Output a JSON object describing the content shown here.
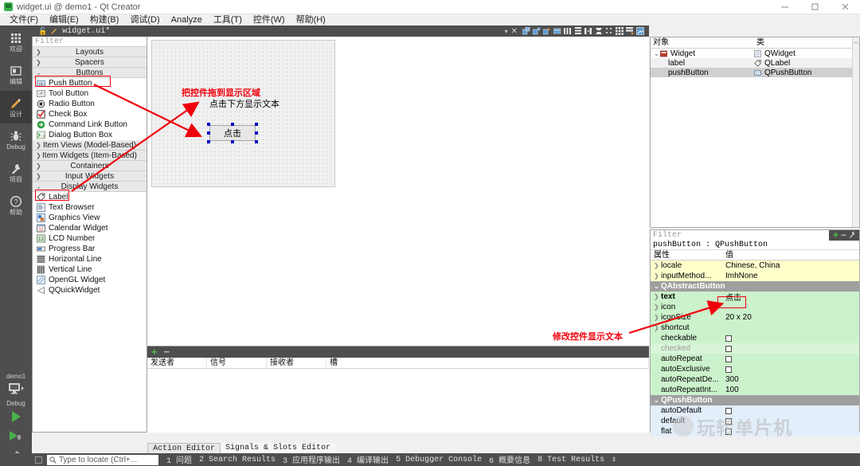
{
  "window": {
    "title": "widget.ui @ demo1 - Qt Creator",
    "minimize": "—",
    "maximize": "❐",
    "close": "✕"
  },
  "menubar": {
    "items": [
      "文件(F)",
      "编辑(E)",
      "构建(B)",
      "调试(D)",
      "Analyze",
      "工具(T)",
      "控件(W)",
      "帮助(H)"
    ]
  },
  "rail": {
    "items": [
      {
        "label": "欢迎",
        "icon": "grid-icon"
      },
      {
        "label": "编辑",
        "icon": "edit-icon"
      },
      {
        "label": "设计",
        "icon": "pencil-icon"
      },
      {
        "label": "Debug",
        "icon": "bug-icon"
      },
      {
        "label": "项目",
        "icon": "wrench-icon"
      },
      {
        "label": "帮助",
        "icon": "question-icon"
      }
    ],
    "kit_name": "demo1",
    "build_config": "Debug"
  },
  "editor_toolbar": {
    "filename": "widget.ui*",
    "close_label": "✕"
  },
  "widgetbox": {
    "filter_placeholder": "Filter",
    "groups": [
      {
        "label": "Layouts",
        "expanded": false,
        "items": []
      },
      {
        "label": "Spacers",
        "expanded": false,
        "items": []
      },
      {
        "label": "Buttons",
        "expanded": true,
        "items": [
          {
            "label": "Push Button",
            "icon": "push-button-icon"
          },
          {
            "label": "Tool Button",
            "icon": "tool-button-icon"
          },
          {
            "label": "Radio Button",
            "icon": "radio-button-icon"
          },
          {
            "label": "Check Box",
            "icon": "check-box-icon"
          },
          {
            "label": "Command Link Button",
            "icon": "command-link-icon"
          },
          {
            "label": "Dialog Button Box",
            "icon": "dialog-button-box-icon"
          }
        ]
      },
      {
        "label": "Item Views (Model-Based)",
        "expanded": false,
        "items": []
      },
      {
        "label": "Item Widgets (Item-Based)",
        "expanded": false,
        "items": []
      },
      {
        "label": "Containers",
        "expanded": false,
        "items": []
      },
      {
        "label": "Input Widgets",
        "expanded": false,
        "items": []
      },
      {
        "label": "Display Widgets",
        "expanded": true,
        "items": [
          {
            "label": "Label",
            "icon": "label-icon"
          },
          {
            "label": "Text Browser",
            "icon": "text-browser-icon"
          },
          {
            "label": "Graphics View",
            "icon": "graphics-view-icon"
          },
          {
            "label": "Calendar Widget",
            "icon": "calendar-icon"
          },
          {
            "label": "LCD Number",
            "icon": "lcd-number-icon"
          },
          {
            "label": "Progress Bar",
            "icon": "progress-bar-icon"
          },
          {
            "label": "Horizontal Line",
            "icon": "horizontal-line-icon"
          },
          {
            "label": "Vertical Line",
            "icon": "vertical-line-icon"
          },
          {
            "label": "OpenGL Widget",
            "icon": "opengl-icon"
          },
          {
            "label": "QQuickWidget",
            "icon": "qquick-icon"
          }
        ]
      }
    ]
  },
  "canvas": {
    "label_text": "点击下方显示文本",
    "button_text": "点击"
  },
  "annotations": [
    {
      "text": "把控件拖到显示区域",
      "color": "#f0000c"
    },
    {
      "text": "修改控件显示文本",
      "color": "#f0000c"
    }
  ],
  "signals_slots": {
    "columns": [
      "发送者",
      "信号",
      "接收者",
      "槽"
    ],
    "rows": []
  },
  "bottom_tabs": {
    "items": [
      {
        "label": "Action Editor",
        "active": true
      },
      {
        "label": "Signals & Slots Editor",
        "active": false
      }
    ]
  },
  "object_inspector": {
    "columns": [
      "对象",
      "类"
    ],
    "rows": [
      {
        "object": "Widget",
        "class": "QWidget",
        "depth": 0,
        "expander": "⌄",
        "icon": "widget-icon",
        "class_icon": "qwidget-icon",
        "selected": false
      },
      {
        "object": "label",
        "class": "QLabel",
        "depth": 1,
        "expander": "",
        "icon": "",
        "class_icon": "qlabel-icon",
        "selected": false
      },
      {
        "object": "pushButton",
        "class": "QPushButton",
        "depth": 1,
        "expander": "",
        "icon": "",
        "class_icon": "qpushbutton-icon",
        "selected": true
      }
    ]
  },
  "property_editor": {
    "filter_placeholder": "Filter",
    "object_header": "pushButton : QPushButton",
    "columns": [
      "属性",
      "值"
    ],
    "add_button": "+",
    "remove_button": "−",
    "config_button": "config-icon",
    "rows": [
      {
        "name": "locale",
        "value": "Chinese, China",
        "type": "text",
        "bg": "yellow",
        "expander": ">",
        "group": false
      },
      {
        "name": "inputMethod...",
        "value": "ImhNone",
        "type": "text",
        "bg": "yellow",
        "expander": ">",
        "group": false
      },
      {
        "name": "QAbstractButton",
        "value": "",
        "type": "group",
        "bg": "group",
        "expander": "⌄",
        "group": true
      },
      {
        "name": "text",
        "value": "点击",
        "type": "text",
        "bg": "green",
        "expander": ">",
        "group": false,
        "bold": true,
        "highlight": true
      },
      {
        "name": "icon",
        "value": "",
        "type": "text",
        "bg": "green",
        "expander": ">",
        "group": false
      },
      {
        "name": "iconSize",
        "value": "20 x 20",
        "type": "text",
        "bg": "green",
        "expander": ">",
        "group": false
      },
      {
        "name": "shortcut",
        "value": "",
        "type": "text",
        "bg": "green",
        "expander": ">",
        "group": false
      },
      {
        "name": "checkable",
        "value": "",
        "type": "checkbox",
        "bg": "green",
        "expander": "",
        "group": false
      },
      {
        "name": "checked",
        "value": "",
        "type": "checkbox",
        "bg": "green2",
        "expander": "",
        "group": false,
        "disabled": true
      },
      {
        "name": "autoRepeat",
        "value": "",
        "type": "checkbox",
        "bg": "green",
        "expander": "",
        "group": false
      },
      {
        "name": "autoExclusive",
        "value": "",
        "type": "checkbox",
        "bg": "green",
        "expander": "",
        "group": false
      },
      {
        "name": "autoRepeatDe...",
        "value": "300",
        "type": "text",
        "bg": "green",
        "expander": "",
        "group": false
      },
      {
        "name": "autoRepeatInt...",
        "value": "100",
        "type": "text",
        "bg": "green",
        "expander": "",
        "group": false
      },
      {
        "name": "QPushButton",
        "value": "",
        "type": "group",
        "bg": "group",
        "expander": "⌄",
        "group": true
      },
      {
        "name": "autoDefault",
        "value": "",
        "type": "checkbox",
        "bg": "blue",
        "expander": "",
        "group": false
      },
      {
        "name": "default",
        "value": "",
        "type": "checkbox",
        "bg": "blue",
        "expander": "",
        "group": false
      },
      {
        "name": "flat",
        "value": "",
        "type": "checkbox",
        "bg": "blue",
        "expander": "",
        "group": false
      }
    ]
  },
  "watermark": {
    "text": "玩转单片机"
  },
  "statusbar": {
    "search_placeholder": "Type to locate (Ctrl+...",
    "items": [
      "1 问题",
      "2 Search Results",
      "3 应用程序输出",
      "4 编译输出",
      "5 Debugger Console",
      "6 概要信息",
      "8 Test Results",
      "⇕"
    ]
  }
}
